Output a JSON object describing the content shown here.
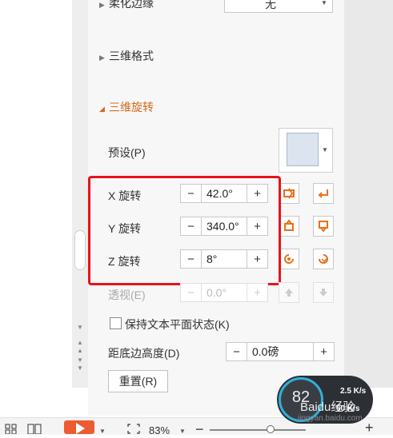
{
  "panel": {
    "soft_edge": {
      "label": "柔化边缘",
      "value": "无"
    },
    "section_3d_format": "三维格式",
    "section_3d_rotation": "三维旋转",
    "preset_label": "预设(P)",
    "preset_swatch_color": "#dbe4ef",
    "x_rotation": {
      "label": "X 旋转",
      "value": "42.0°"
    },
    "y_rotation": {
      "label": "Y 旋转",
      "value": "340.0°"
    },
    "z_rotation": {
      "label": "Z 旋转",
      "value": "8°"
    },
    "perspective": {
      "label": "透视(E)",
      "value": "0.0°"
    },
    "keep_text_flat": {
      "label": "保持文本平面状态(K)",
      "checked": false
    },
    "distance_from_ground": {
      "label": "距底边高度(D)",
      "value": "0.0磅"
    },
    "reset_button": "重置(R)",
    "minus": "−",
    "plus": "+",
    "highlight_color": "#e8121c"
  },
  "statusbar": {
    "zoom": "83%",
    "zoom_minus": "−",
    "zoom_plus": "+"
  },
  "speed_widget": {
    "value": "82",
    "upload": "2.5 K/s",
    "download": "60 K/s",
    "watermark": "Baidu经验",
    "watermark_sub": "jingyan.baidu.com"
  }
}
